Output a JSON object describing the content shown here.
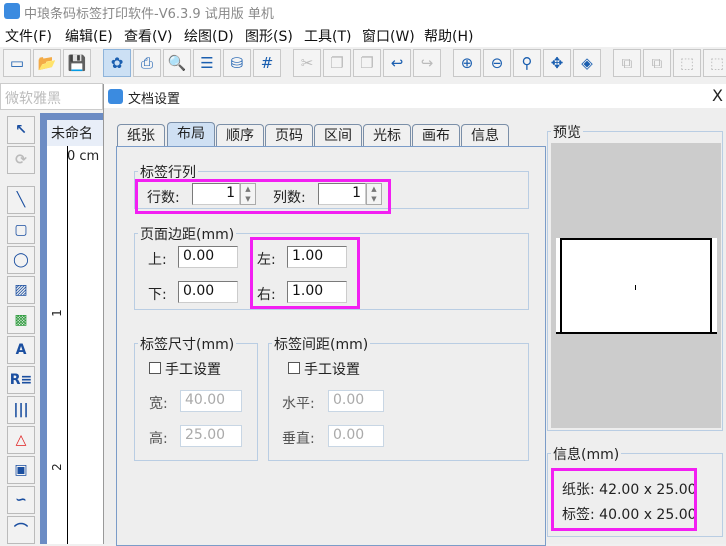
{
  "app": {
    "title": "中琅条码标签打印软件-V6.3.9 试用版 单机"
  },
  "menu": [
    "文件(F)",
    "编辑(E)",
    "查看(V)",
    "绘图(D)",
    "图形(S)",
    "工具(T)",
    "窗口(W)",
    "帮助(H)"
  ],
  "toolbar": {
    "icons": [
      "new-icon",
      "open-icon",
      "save-icon",
      "settings-icon",
      "print-icon",
      "print-preview-icon",
      "database-icon",
      "database-connect-icon",
      "grid-icon",
      "cut-icon",
      "copy-icon",
      "paste-icon",
      "undo-icon",
      "redo-icon",
      "zoom-in-icon",
      "zoom-out-icon",
      "zoom-fit-icon",
      "fit-page-icon",
      "fit-width-icon",
      "align-icon",
      "align-2-icon",
      "group-icon",
      "ungroup-icon"
    ]
  },
  "fontbar": {
    "font": "微软雅黑"
  },
  "palette": [
    "pointer-icon",
    "rotate-icon",
    "line-icon",
    "rounded-rect-icon",
    "ellipse-icon",
    "image-icon",
    "picture-icon",
    "text-icon",
    "rich-text-icon",
    "barcode-icon",
    "shape-icon",
    "qrcode-icon",
    "curve-icon",
    "arc-icon"
  ],
  "document": {
    "tab": "未命名",
    "ruler_unit": "0 cm",
    "ruler_marks": [
      "1",
      "2"
    ]
  },
  "dialog": {
    "title": "文档设置",
    "close": "X",
    "tabs": [
      "纸张",
      "布局",
      "顺序",
      "页码",
      "区间",
      "光标",
      "画布",
      "信息"
    ],
    "active_tab": "布局",
    "grid": {
      "label": "标签行列",
      "rows_label": "行数:",
      "rows": "1",
      "cols_label": "列数:",
      "cols": "1"
    },
    "margins": {
      "label": "页面边距(mm)",
      "top_label": "上:",
      "top": "0.00",
      "bottom_label": "下:",
      "bottom": "0.00",
      "left_label": "左:",
      "left": "1.00",
      "right_label": "右:",
      "right": "1.00"
    },
    "size": {
      "label": "标签尺寸(mm)",
      "manual": "手工设置",
      "width_label": "宽:",
      "width": "40.00",
      "height_label": "高:",
      "height": "25.00"
    },
    "spacing": {
      "label": "标签间距(mm)",
      "manual": "手工设置",
      "h_label": "水平:",
      "h": "0.00",
      "v_label": "垂直:",
      "v": "0.00"
    },
    "preview": {
      "label": "预览"
    },
    "info": {
      "label": "信息(mm)",
      "paper": "纸张: 42.00 x 25.00",
      "label_size": "标签: 40.00 x 25.00"
    }
  },
  "highlight_color": "#f21ff2"
}
